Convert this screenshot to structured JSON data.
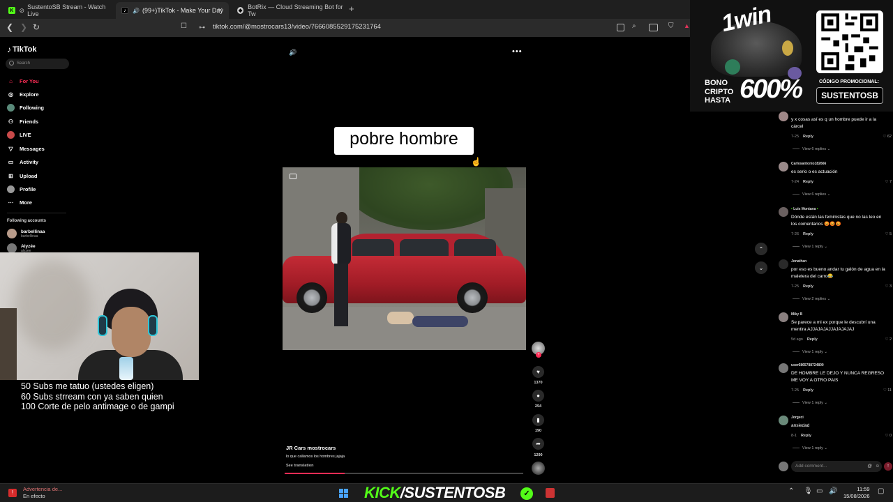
{
  "browser": {
    "tabs": [
      {
        "title": "SustentoSB Stream - Watch Live",
        "active": false
      },
      {
        "title": "(99+)TikTok - Make Your Day",
        "active": true
      },
      {
        "title": "BotRix — Cloud Streaming Bot for Tw",
        "active": false
      }
    ],
    "new_tab": "+",
    "url": "tiktok.com/@mostrocars13/video/7666085529175231764"
  },
  "tiktok": {
    "logo": "TikTok",
    "search_placeholder": "Search",
    "nav": [
      {
        "label": "For You",
        "icon": "home-icon",
        "active": true
      },
      {
        "label": "Explore",
        "icon": "compass-icon",
        "active": false
      },
      {
        "label": "Following",
        "icon": "following-avatar",
        "active": false
      },
      {
        "label": "Friends",
        "icon": "friends-icon",
        "active": false
      },
      {
        "label": "LIVE",
        "icon": "live-avatar",
        "active": false
      },
      {
        "label": "Messages",
        "icon": "messages-icon",
        "active": false
      },
      {
        "label": "Activity",
        "icon": "activity-icon",
        "active": false
      },
      {
        "label": "Upload",
        "icon": "upload-icon",
        "active": false
      },
      {
        "label": "Profile",
        "icon": "profile-avatar",
        "active": false
      },
      {
        "label": "More",
        "icon": "more-icon",
        "active": false
      }
    ],
    "following_header": "Following accounts",
    "following": [
      {
        "name": "barbellinaa",
        "handle": "barbellinaa"
      },
      {
        "name": "Alyzée",
        "handle": "alyzee"
      }
    ]
  },
  "stream_goals": [
    "50 Subs me tatuo (ustedes eligen)",
    "60 Subs strream con ya saben quien",
    "100 Corte de pelo antimage o de gampi"
  ],
  "video": {
    "caption_overlay": "pobre hombre",
    "author": "JR Cars mostrocars",
    "description": "lo que callamos los hombres jajaja",
    "see_translation": "See translation",
    "progress": 0.25,
    "likes": "1370",
    "comments": "254",
    "saves": "190",
    "shares": "1290"
  },
  "promo": {
    "brand": "1win",
    "bono_lines": [
      "BONO",
      "CRIPTO",
      "HASTA"
    ],
    "percent": "600%",
    "code_label": "CÓDIGO PROMOCIONAL:",
    "code": "SUSTENTOSB"
  },
  "comments": [
    {
      "user": "",
      "text": "y x cosas así es q un hombre puede ir a la cárcel",
      "date": "7-25",
      "reply": "Reply",
      "likes": "62",
      "views": "View 6 replies"
    },
    {
      "user": "Carlosantonio182666",
      "text": "es serio o es actuación",
      "date": "7-24",
      "reply": "Reply",
      "likes": "7",
      "views": "View 6 replies"
    },
    {
      "user": "Luis Montana",
      "text": "Dónde están las feministas que no las leo en los comentarios 😡😡😡",
      "date": "7-26",
      "reply": "Reply",
      "likes": "5",
      "views": "View 1 reply"
    },
    {
      "user": "Jonathan",
      "text": "por eso es bueno andar tu galón de agua en la maletera del carro😂",
      "date": "7-25",
      "reply": "Reply",
      "likes": "3",
      "views": "View 2 replies"
    },
    {
      "user": "Miky B",
      "text": "Se parece a mi ex porque le descubrí una mentira AJJAJAJAJJAJAJAJAJ",
      "date": "5d ago",
      "reply": "Reply",
      "likes": "2",
      "views": "View 1 reply"
    },
    {
      "user": "user6865788724800",
      "text": "DE HOMBRE LE DEJO Y NUNCA REGRESO ME VOY A OTRO PAIS",
      "date": "7-25",
      "reply": "Reply",
      "likes": "11",
      "views": "View 1 reply"
    },
    {
      "user": "Jorgeci",
      "text": "ansiedad",
      "date": "8-1",
      "reply": "Reply",
      "likes": "0",
      "views": "View 1 reply"
    }
  ],
  "comment_input": {
    "placeholder": "Add comment..."
  },
  "taskbar": {
    "alert_title": "Advertencia de...",
    "alert_status": "En efecto",
    "kick_prefix": "KICK",
    "kick_channel": "/SUSTENTOSB",
    "time": "11:59",
    "date": "15/08/2026"
  },
  "colors": {
    "tiktok_red": "#fe2c55",
    "kick_green": "#53fc18"
  }
}
